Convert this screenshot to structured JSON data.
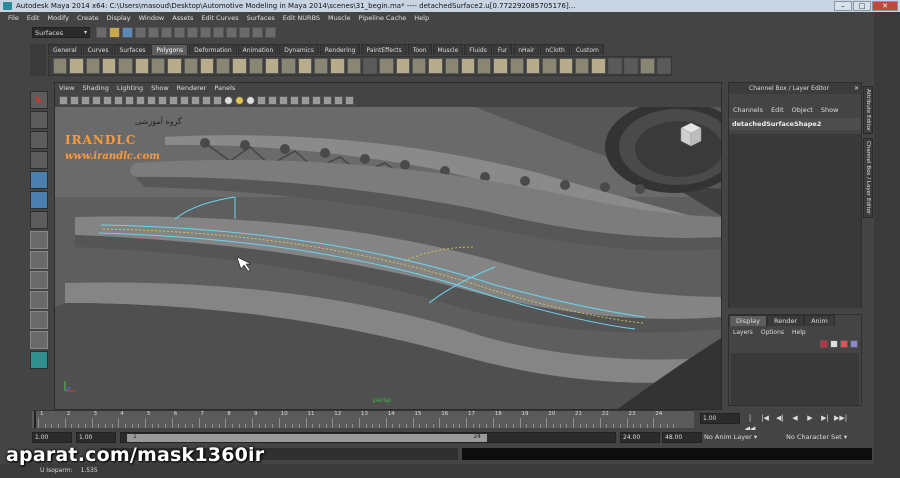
{
  "window": {
    "title": "Autodesk Maya 2014 x64: C:\\Users\\masoud\\Desktop\\Automotive Modeling in Maya 2014\\scenes\\31_begin.ma*   ----   detachedSurface2.u[0.772292085705176]...",
    "min": "–",
    "max": "□",
    "close": "✕"
  },
  "menubar": [
    "File",
    "Edit",
    "Modify",
    "Create",
    "Display",
    "Window",
    "Assets",
    "Edit Curves",
    "Surfaces",
    "Edit NURBS",
    "Muscle",
    "Pipeline Cache",
    "Help"
  ],
  "status_line": {
    "mode": "Surfaces"
  },
  "shelf_tabs": [
    "General",
    "Curves",
    "Surfaces",
    "Polygons",
    "Deformation",
    "Animation",
    "Dynamics",
    "Rendering",
    "PaintEffects",
    "Toon",
    "Muscle",
    "Fluids",
    "Fur",
    "nHair",
    "nCloth",
    "Custom"
  ],
  "shelf_active": "Polygons",
  "viewport": {
    "menu": [
      "View",
      "Shading",
      "Lighting",
      "Show",
      "Renderer",
      "Panels"
    ],
    "camera_label": "persp",
    "watermark_fa": "گروه آموزشی",
    "watermark_brand": "IRANDLC",
    "watermark_url": "www.irandlc.com"
  },
  "channel_box": {
    "header": "Channel Box / Layer Editor",
    "menu": [
      "Channels",
      "Edit",
      "Object",
      "Show"
    ],
    "object_name": "detachedSurfaceShape2"
  },
  "side_tabs": [
    "Attribute Editor",
    "Channel Box / Layer Editor"
  ],
  "layer_editor": {
    "tabs": [
      "Display",
      "Render",
      "Anim"
    ],
    "active_tab": "Display",
    "menu": [
      "Layers",
      "Options",
      "Help"
    ]
  },
  "timeline": {
    "ticks": [
      "1",
      "2",
      "3",
      "4",
      "5",
      "6",
      "7",
      "8",
      "9",
      "10",
      "11",
      "12",
      "13",
      "14",
      "15",
      "16",
      "17",
      "18",
      "19",
      "20",
      "21",
      "22",
      "23",
      "24"
    ],
    "current_time": "1.00",
    "play_buttons": [
      "|◀◀",
      "|◀",
      "◀|",
      "◀",
      "▶",
      "▶|",
      "▶▶|"
    ]
  },
  "range": {
    "start": "1.00",
    "start_inner": "1.00",
    "slider_start": "1",
    "slider_end": "24",
    "end_inner": "24.00",
    "end": "48.00",
    "anim_layer": "No Anim Layer",
    "character_set": "No Character Set"
  },
  "help_line": {
    "label": "U Isoparm:",
    "value": "1.535"
  },
  "overlay": {
    "aparat": "aparat.com/mask1360ir"
  }
}
